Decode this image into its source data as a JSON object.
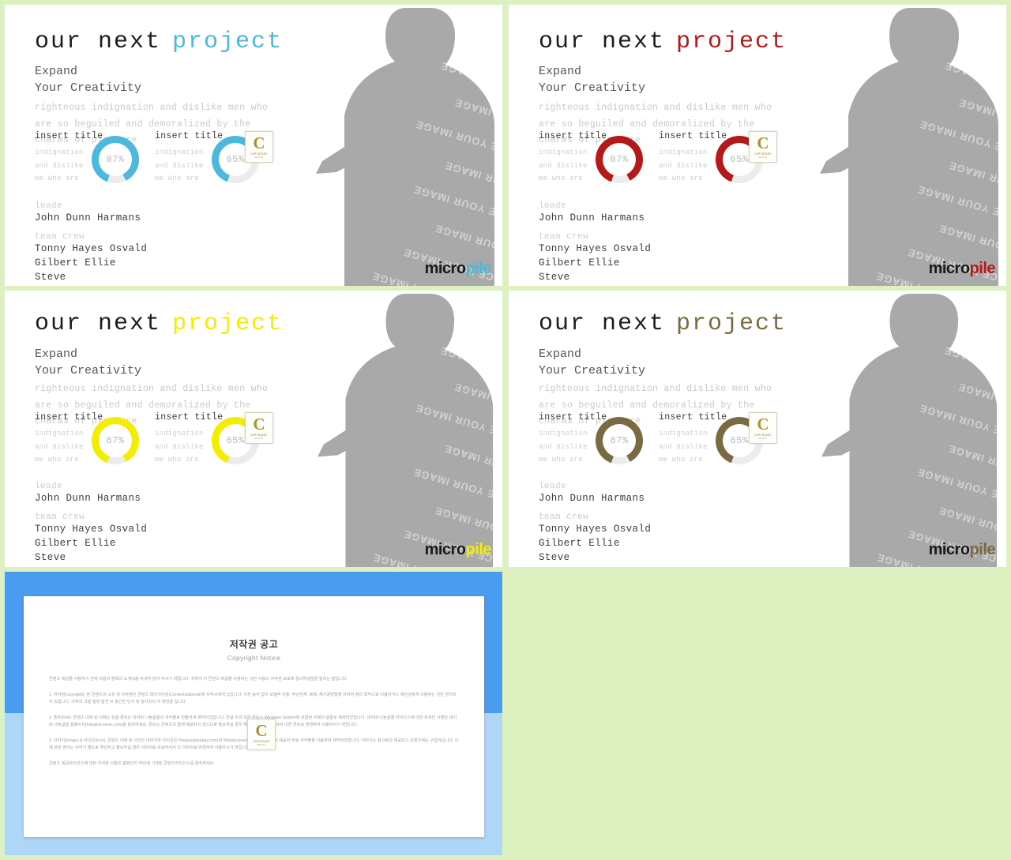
{
  "background": {
    "green": "#dcf0c0",
    "blue_dark": "#4a9cf0",
    "blue_light": "#aed6f7"
  },
  "watermark": {
    "image_text": "REPLACE YOUR IMAGE",
    "badge_letter": "C",
    "badge_line1": "COPYRIGHT",
    "badge_line2": "NOTICE"
  },
  "brand": {
    "dark_part": "micro",
    "accent_part": "pile"
  },
  "slides": [
    {
      "id": "slide-blue",
      "accent": "#4bb8dc",
      "headline_dark": "our next",
      "headline_accent": "project",
      "subtitle_line1": "Expand",
      "subtitle_line2": "Your Creativity",
      "body_line1": "righteous indignation and dislike men who",
      "body_line2": "are so beguiled and demoralized by the",
      "body_line3": "charms of pleasure",
      "stats": [
        {
          "title": "insert title",
          "lines": "indignation\nand dislike\nme who are",
          "value": "87%",
          "percent": 87
        },
        {
          "title": "insert title",
          "lines": "indignation\nand dislike\nme who are",
          "value": "65%",
          "percent": 65
        }
      ],
      "credits": [
        {
          "label": "leade",
          "names": [
            "John Dunn Harmans"
          ]
        },
        {
          "label": "team crew",
          "names": [
            "Tonny Hayes Osvald",
            "Gilbert Ellie",
            "Steve"
          ]
        }
      ]
    },
    {
      "id": "slide-red",
      "accent": "#b51a1a",
      "headline_dark": "our next",
      "headline_accent": "project",
      "subtitle_line1": "Expand",
      "subtitle_line2": "Your Creativity",
      "body_line1": "righteous indignation and dislike men who",
      "body_line2": "are so beguiled and demoralized by the",
      "body_line3": "charms of pleasure",
      "stats": [
        {
          "title": "insert title",
          "lines": "indignation\nand dislike\nme who are",
          "value": "87%",
          "percent": 87
        },
        {
          "title": "insert title",
          "lines": "indignation\nand dislike\nme who are",
          "value": "65%",
          "percent": 65
        }
      ],
      "credits": [
        {
          "label": "leade",
          "names": [
            "John Dunn Harmans"
          ]
        },
        {
          "label": "team crew",
          "names": [
            "Tonny Hayes Osvald",
            "Gilbert Ellie",
            "Steve"
          ]
        }
      ]
    },
    {
      "id": "slide-yellow",
      "accent": "#f5ed00",
      "headline_dark": "our next",
      "headline_accent": "project",
      "subtitle_line1": "Expand",
      "subtitle_line2": "Your Creativity",
      "body_line1": "righteous indignation and dislike men who",
      "body_line2": "are so beguiled and demoralized by the",
      "body_line3": "charms of pleasure",
      "stats": [
        {
          "title": "insert title",
          "lines": "indignation\nand dislike\nme who are",
          "value": "87%",
          "percent": 87
        },
        {
          "title": "insert title",
          "lines": "indignation\nand dislike\nme who are",
          "value": "65%",
          "percent": 65
        }
      ],
      "credits": [
        {
          "label": "leade",
          "names": [
            "John Dunn Harmans"
          ]
        },
        {
          "label": "team crew",
          "names": [
            "Tonny Hayes Osvald",
            "Gilbert Ellie",
            "Steve"
          ]
        }
      ]
    },
    {
      "id": "slide-brown",
      "accent": "#7a6a42",
      "headline_dark": "our next",
      "headline_accent": "project",
      "subtitle_line1": "Expand",
      "subtitle_line2": "Your Creativity",
      "body_line1": "righteous indignation and dislike men who",
      "body_line2": "are so beguiled and demoralized by the",
      "body_line3": "charms of pleasure",
      "stats": [
        {
          "title": "insert title",
          "lines": "indignation\nand dislike\nme who are",
          "value": "87%",
          "percent": 87
        },
        {
          "title": "insert title",
          "lines": "indignation\nand dislike\nme who are",
          "value": "65%",
          "percent": 65
        }
      ],
      "credits": [
        {
          "label": "leade",
          "names": [
            "John Dunn Harmans"
          ]
        },
        {
          "label": "team crew",
          "names": [
            "Tonny Hayes Osvald",
            "Gilbert Ellie",
            "Steve"
          ]
        }
      ]
    }
  ],
  "copyright_slide": {
    "title_ko": "저작권 공고",
    "title_en": "Copyright Notice",
    "intro": "콘텐츠 제공물 사용하기 전에 다음의 항목의 소개내용 자세히 읽어 주시기 바랍니다. 귀하가 이 콘텐츠 제공물 사용하는 것만 사용시 저작권 보호에 동의하셨음을 알리는 말입니다.",
    "section1": "1. 저작권(copyright): 본 콘텐츠의 소유 및 저작권은 콘텐츠 테이크아웃(Contentstakeout)에 저작시에게 있습니다. 사전 승낙 없이 모델적 이용, 무단전재, 복제, 재가공방법에 의하여 영리 목적으로 이용하거나 재산상에게 이용하는 것만 금지되어 있습니다. 이후의 고발 행위 발견 시 중간한 민사 및 형사상의 자 책임을 집니다.",
    "section2": "2. 폰트(font): 콘텐츠 내에 된 서체는 한글 폰트는 네이버 나눔글꼴의 저작물로 만들어져 제작되었습니다. 한글 외의 모든 폰트는 Windows System에 포함된 서체의 글꼴로 제작되었습니다. 네이버 나눔글꼴 라이선스에 대한 자세한 사항은 네이버 나눔글꼴 홈페이지(hangeul.naver.com)를 참조하세요. 폰트는 콘텐츠의 함께 제공되지 않으므로 필요하실 경우 해당 폰트를 구입하셔서 다른 폰트로 변경하여 사용하시기 바랍니다.",
    "section3": "3. 이미지(image) & 아이콘(icon): 콘텐츠 내에 된 사진은 이미지와 아이콘은 Pixabay(pixabay.com)와 Webalys(webalys.com) 등에서 제공한 무료 저작물을 이용하여 제작되었습니다. 이미지는 참고로만 제공되고 콘텐츠에는 구입하십니다. 이에 관한 권리는 귀하가 별도로 확인하고 필요하실 경우 이미지를 유료하셔서 다 이미지를 변경하여 사용하시기 바랍니다.",
    "footer": "콘텐츠 제공라이선스에 대한 자세한 사항은 홈페이지 하단에 기재된 콘텐츠라이선스를 참조하세요."
  }
}
